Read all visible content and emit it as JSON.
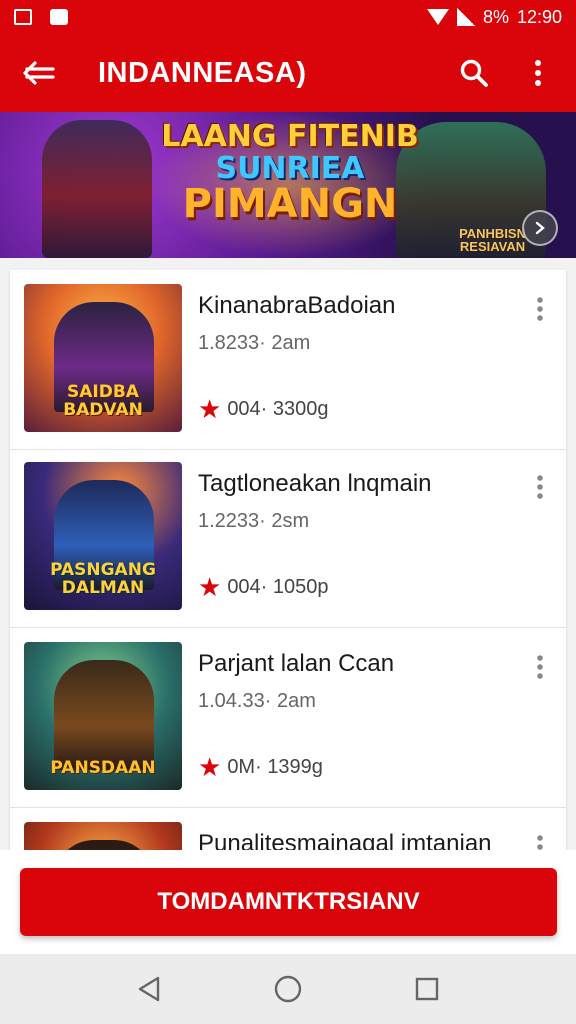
{
  "status_bar": {
    "battery": "8%",
    "time": "12:90"
  },
  "app_bar": {
    "title": "INDANNEASA)"
  },
  "banner": {
    "title_line1": "LAANG FITENIB",
    "title_line2": "SUNRIEA",
    "title_line3": "PIMANGN",
    "subtitle": "PANHBISN\nRESIAVAN"
  },
  "items": [
    {
      "title": "KinanabraBadoian",
      "meta": "1.8233· 2am",
      "rating": "004· 3300g",
      "thumb_label": "SAIDBA\nBADVAN",
      "thumb_bg": "#e0662a",
      "thumb_fig": "#6d2a88",
      "label_color": "#ffcc33"
    },
    {
      "title": "Tagtloneakan lnqmain",
      "meta": "1.2233· 2sm",
      "rating": "004· 1050p",
      "thumb_label": "PASNGANG\nDALMAN",
      "thumb_bg": "#3a2a7a",
      "thumb_fig": "#2e5fb8",
      "label_color": "#ffd23a"
    },
    {
      "title": "Parjant lalan Ccan",
      "meta": "1.04.33· 2am",
      "rating": "0M· 1399g",
      "thumb_label": "PANSDAAN",
      "thumb_bg": "#2a6e6a",
      "thumb_fig": "#7a4a1e",
      "label_color": "#ffc02e"
    },
    {
      "title": "Punalitesmainagal imtanian",
      "meta": "",
      "rating": "",
      "thumb_label": "",
      "thumb_bg": "#b2381e",
      "thumb_fig": "#4a1e14",
      "label_color": "#ffc02e"
    }
  ],
  "cta": {
    "label": "TOMDAMNTKTRSIANV"
  },
  "colors": {
    "accent": "#d9050a",
    "star": "#d9050a"
  },
  "icons": [
    "back-arrow-icon",
    "search-icon",
    "more-vert-icon",
    "star-icon",
    "nav-back-icon",
    "nav-home-icon",
    "nav-recents-icon"
  ]
}
